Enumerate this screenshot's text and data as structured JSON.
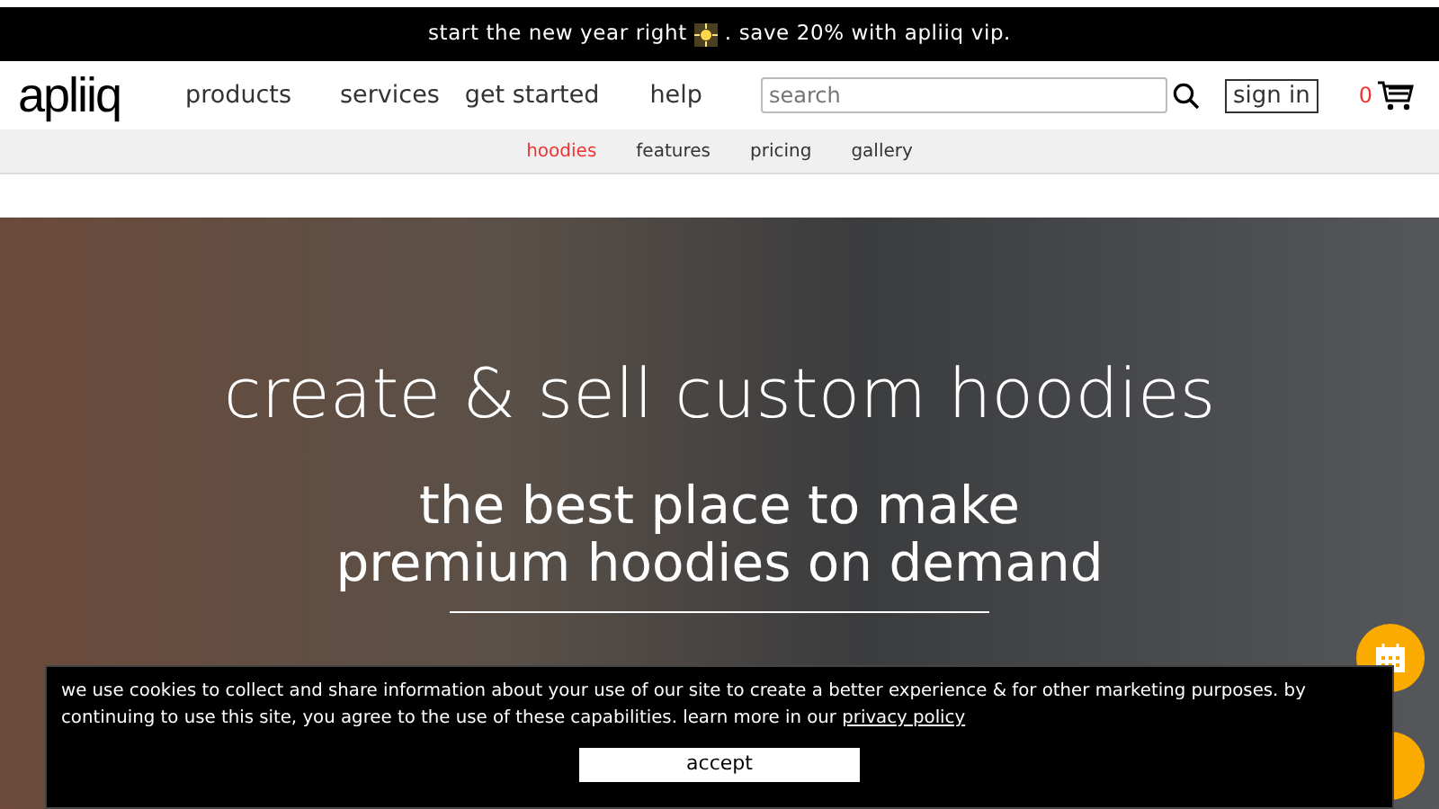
{
  "promo_bar": {
    "text_before": "start the new year right",
    "text_after": ". save 20% with apliiq vip."
  },
  "navbar": {
    "logo": "apliiq",
    "items": [
      "products",
      "services",
      "get started",
      "help"
    ],
    "search": {
      "placeholder": "search"
    },
    "sign_in": "sign in",
    "cart_count": "0"
  },
  "subnav": [
    {
      "label": "hoodies",
      "selected": true
    },
    {
      "label": "features",
      "selected": false
    },
    {
      "label": "pricing",
      "selected": false
    },
    {
      "label": "gallery",
      "selected": false
    }
  ],
  "hero": {
    "title": "create & sell custom hoodies",
    "subtitle_lines": [
      "the best place to make",
      "premium hoodies on demand"
    ]
  },
  "cookie_banner": {
    "text": "we use cookies to collect and share information about your use of our site to create a better experience & for other marketing purposes. by continuing to use this site, you agree to the use of these capabilities. learn more in our",
    "link": "privacy policy",
    "button": "accept"
  }
}
